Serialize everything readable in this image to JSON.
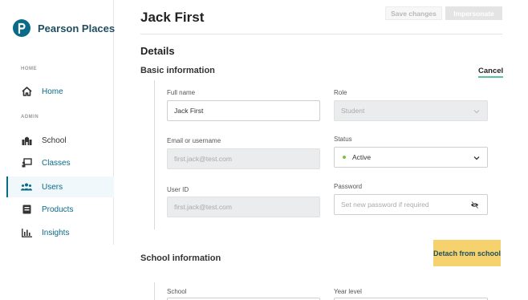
{
  "brand": {
    "name": "Pearson Places",
    "logo_letter": "P"
  },
  "sidebar": {
    "sections": [
      {
        "label": "HOME"
      },
      {
        "label": "ADMIN"
      }
    ],
    "items": [
      {
        "label": "Home",
        "icon": "home-icon"
      },
      {
        "label": "School",
        "icon": "school-icon"
      },
      {
        "label": "Classes",
        "icon": "classes-icon"
      },
      {
        "label": "Users",
        "icon": "users-icon",
        "active": true
      },
      {
        "label": "Products",
        "icon": "products-icon"
      },
      {
        "label": "Insights",
        "icon": "insights-icon"
      }
    ]
  },
  "header": {
    "title": "Jack First",
    "save_label": "Save changes",
    "impersonate_label": "Impersonate"
  },
  "details": {
    "heading": "Details",
    "basic_heading": "Basic information",
    "cancel_label": "Cancel",
    "full_name": {
      "label": "Full name",
      "value": "Jack First"
    },
    "role": {
      "label": "Role",
      "value": "Student"
    },
    "email": {
      "label": "Email or username",
      "value": "first.jack@test.com"
    },
    "status": {
      "label": "Status",
      "value": "Active"
    },
    "user_id": {
      "label": "User ID",
      "value": "first.jack@test.com"
    },
    "password": {
      "label": "Password",
      "placeholder": "Set new password if required"
    }
  },
  "school_info": {
    "heading": "School information",
    "detach_label": "Detach from school",
    "school_label": "School",
    "year_level_label": "Year level"
  },
  "colors": {
    "accent": "#0a6a87",
    "detach_bg": "#f5d26e",
    "status_active": "#7cc242",
    "cancel_underline": "#57c1a3"
  }
}
